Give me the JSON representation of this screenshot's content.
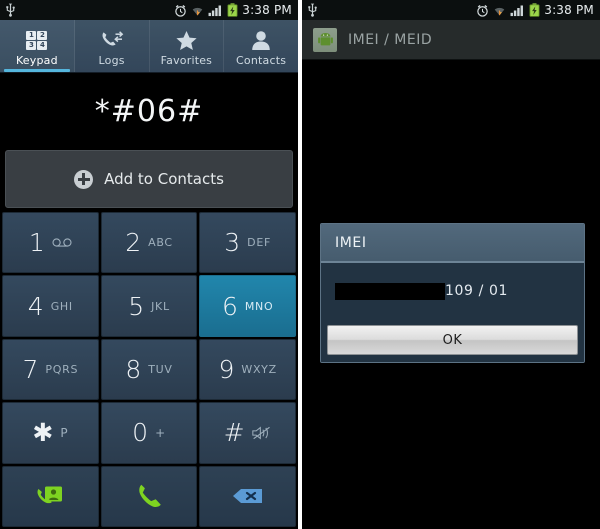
{
  "status_bar": {
    "usb_icon": "usb-icon",
    "alarm_icon": "alarm-clock-icon",
    "wifi_icon": "wifi-icon",
    "signal_icon": "signal-bars-icon",
    "battery_icon": "battery-charging-icon",
    "time": "3:38 PM"
  },
  "dialer": {
    "tabs": [
      {
        "label": "Keypad",
        "icon": "keypad-grid-icon",
        "active": true
      },
      {
        "label": "Logs",
        "icon": "call-logs-icon",
        "active": false
      },
      {
        "label": "Favorites",
        "icon": "star-icon",
        "active": false
      },
      {
        "label": "Contacts",
        "icon": "person-icon",
        "active": false
      }
    ],
    "keypad_icon_digits": [
      "1",
      "2",
      "3",
      "4"
    ],
    "dialed_number": "*#06#",
    "add_to_contacts_label": "Add to Contacts",
    "add_to_contacts_icon": "plus-circle-icon",
    "keys": [
      {
        "digit": "1",
        "sub": "",
        "icon": "voicemail-icon",
        "pressed": false
      },
      {
        "digit": "2",
        "sub": "ABC",
        "icon": "",
        "pressed": false
      },
      {
        "digit": "3",
        "sub": "DEF",
        "icon": "",
        "pressed": false
      },
      {
        "digit": "4",
        "sub": "GHI",
        "icon": "",
        "pressed": false
      },
      {
        "digit": "5",
        "sub": "JKL",
        "icon": "",
        "pressed": false
      },
      {
        "digit": "6",
        "sub": "MNO",
        "icon": "",
        "pressed": true
      },
      {
        "digit": "7",
        "sub": "PQRS",
        "icon": "",
        "pressed": false
      },
      {
        "digit": "8",
        "sub": "TUV",
        "icon": "",
        "pressed": false
      },
      {
        "digit": "9",
        "sub": "WXYZ",
        "icon": "",
        "pressed": false
      },
      {
        "digit": "✱",
        "sub": "P",
        "icon": "",
        "pressed": false
      },
      {
        "digit": "0",
        "sub": "+",
        "icon": "",
        "pressed": false
      },
      {
        "digit": "#",
        "sub": "",
        "icon": "mute-icon",
        "pressed": false
      }
    ],
    "action_keys": [
      {
        "name": "video-call-button",
        "icon": "video-call-icon"
      },
      {
        "name": "call-button",
        "icon": "phone-handset-icon"
      },
      {
        "name": "backspace-button",
        "icon": "backspace-icon"
      }
    ]
  },
  "imei_screen": {
    "app_icon": "android-app-icon",
    "title": "IMEI / MEID",
    "dialog": {
      "title": "IMEI",
      "value_redacted": true,
      "value_visible": "109 / 01",
      "ok_label": "OK"
    }
  },
  "colors": {
    "tab_bar": "#3e5365",
    "tab_accent": "#55b6dd",
    "key_normal": "#2f4254",
    "key_pressed": "#1d6d8c",
    "green_action": "#7ed321",
    "backspace_blue": "#5b9bd5",
    "dialog_title": "#4e6578",
    "dialog_body": "#223342",
    "status_bar": "#0b0f0f",
    "action_bar": "#262b2b"
  }
}
